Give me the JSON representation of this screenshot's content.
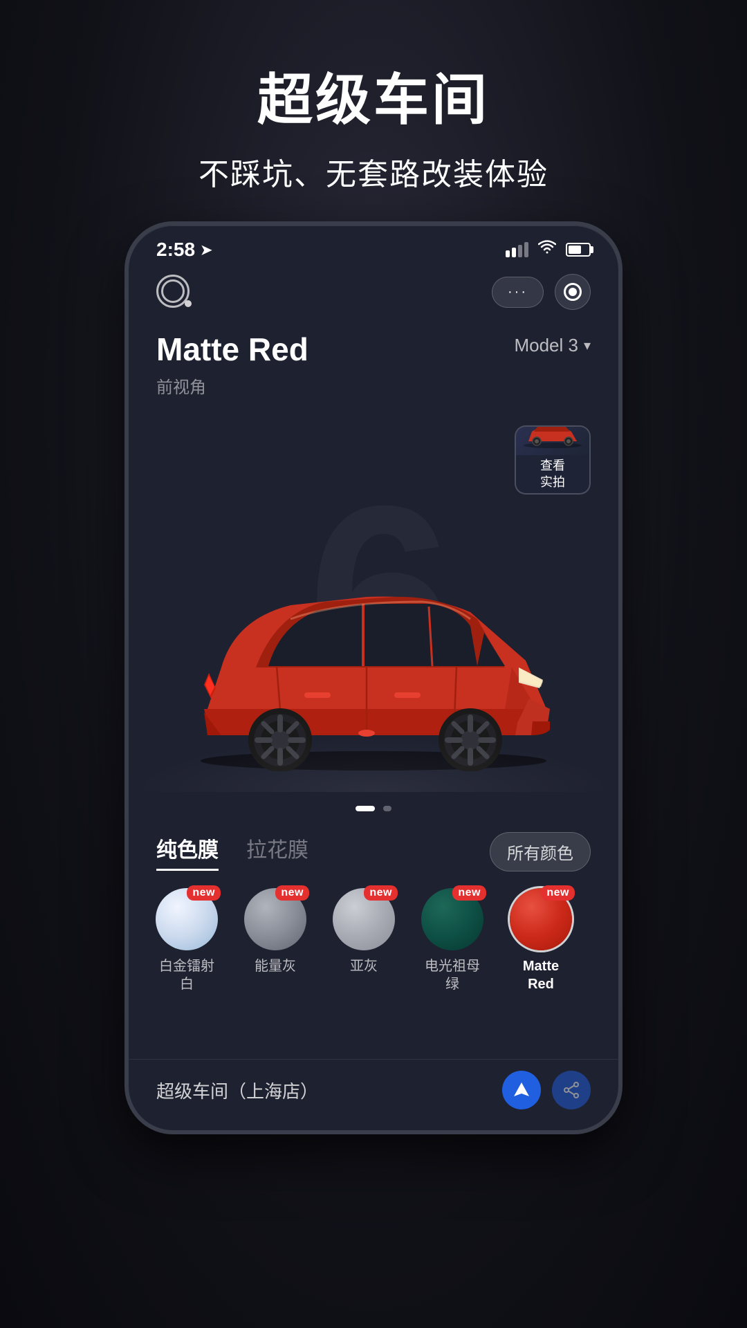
{
  "hero": {
    "title": "超级车间",
    "subtitle": "不踩坑、无套路改装体验"
  },
  "status_bar": {
    "time": "2:58",
    "location_icon": "navigation-icon"
  },
  "app_header": {
    "logo_alt": "app-logo",
    "more_dots": "···",
    "record_icon": "record-icon"
  },
  "car_info": {
    "name": "Matte Red",
    "view_label": "前视角",
    "model": "Model 3",
    "chevron": "▾"
  },
  "preview_thumb": {
    "label": "查看\n实拍"
  },
  "color_tabs": {
    "tab1": "纯色膜",
    "tab2": "拉花膜",
    "all_colors_label": "所有颜色"
  },
  "swatches": [
    {
      "id": "platinum-white",
      "label": "白金镭射\n白",
      "color_stops": [
        "#e8eef5",
        "#c0d0e0",
        "#a8c0d8"
      ],
      "is_new": true,
      "is_active": false
    },
    {
      "id": "energy-grey",
      "label": "能量灰",
      "color_stops": [
        "#9a9ea8",
        "#7a7e88",
        "#5e6270"
      ],
      "is_new": true,
      "is_active": false
    },
    {
      "id": "sub-grey",
      "label": "亚灰",
      "color_stops": [
        "#b8bcc4",
        "#9a9ea8",
        "#888c94"
      ],
      "is_new": true,
      "is_active": false
    },
    {
      "id": "emerald-green",
      "label": "电光祖母\n绿",
      "color_stops": [
        "#1a5a50",
        "#0d4a40",
        "#083830"
      ],
      "is_new": true,
      "is_active": false
    },
    {
      "id": "matte-red",
      "label": "Matte\nRed",
      "color_stops": [
        "#e84030",
        "#c83020",
        "#b02818"
      ],
      "is_new": true,
      "is_active": true
    }
  ],
  "bottom_bar": {
    "shop_name": "超级车间（上海店）",
    "nav_icon1": "location-nav-icon",
    "nav_icon2": "share-icon"
  }
}
